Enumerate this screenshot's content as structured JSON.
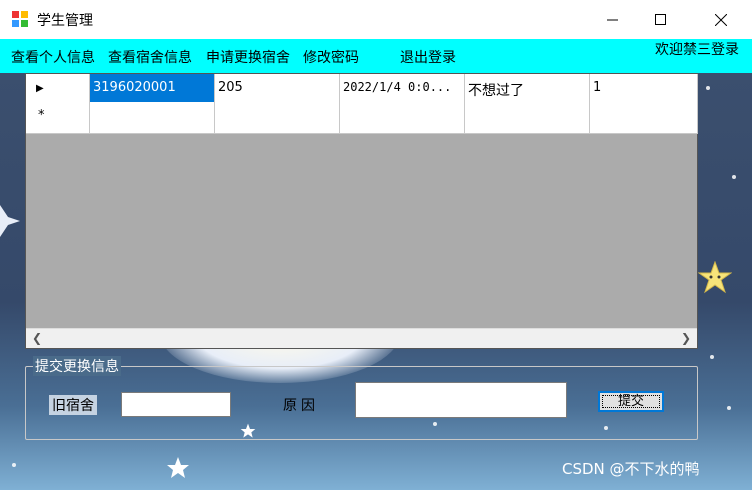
{
  "window": {
    "title": "学生管理"
  },
  "menu": {
    "items": [
      "查看个人信息",
      "查看宿舍信息",
      "申请更换宿舍",
      "修改密码",
      "退出登录"
    ],
    "welcome": "欢迎禁三登录"
  },
  "grid": {
    "rows": [
      {
        "marker": "▶",
        "cells": [
          "3196020001",
          "205",
          "2022/1/4 0:0...",
          "不想过了",
          "1"
        ]
      },
      {
        "marker": "*",
        "cells": [
          "",
          "",
          "",
          "",
          ""
        ]
      }
    ]
  },
  "form": {
    "group_title": "提交更换信息",
    "old_room_label": "旧宿舍",
    "old_room_value": "",
    "reason_label": "原因",
    "reason_value": "",
    "submit_label": "提交"
  },
  "watermark": "CSDN @不下水的鸭",
  "colors": {
    "menubar": "#00ffff",
    "selection": "#0078d7"
  }
}
